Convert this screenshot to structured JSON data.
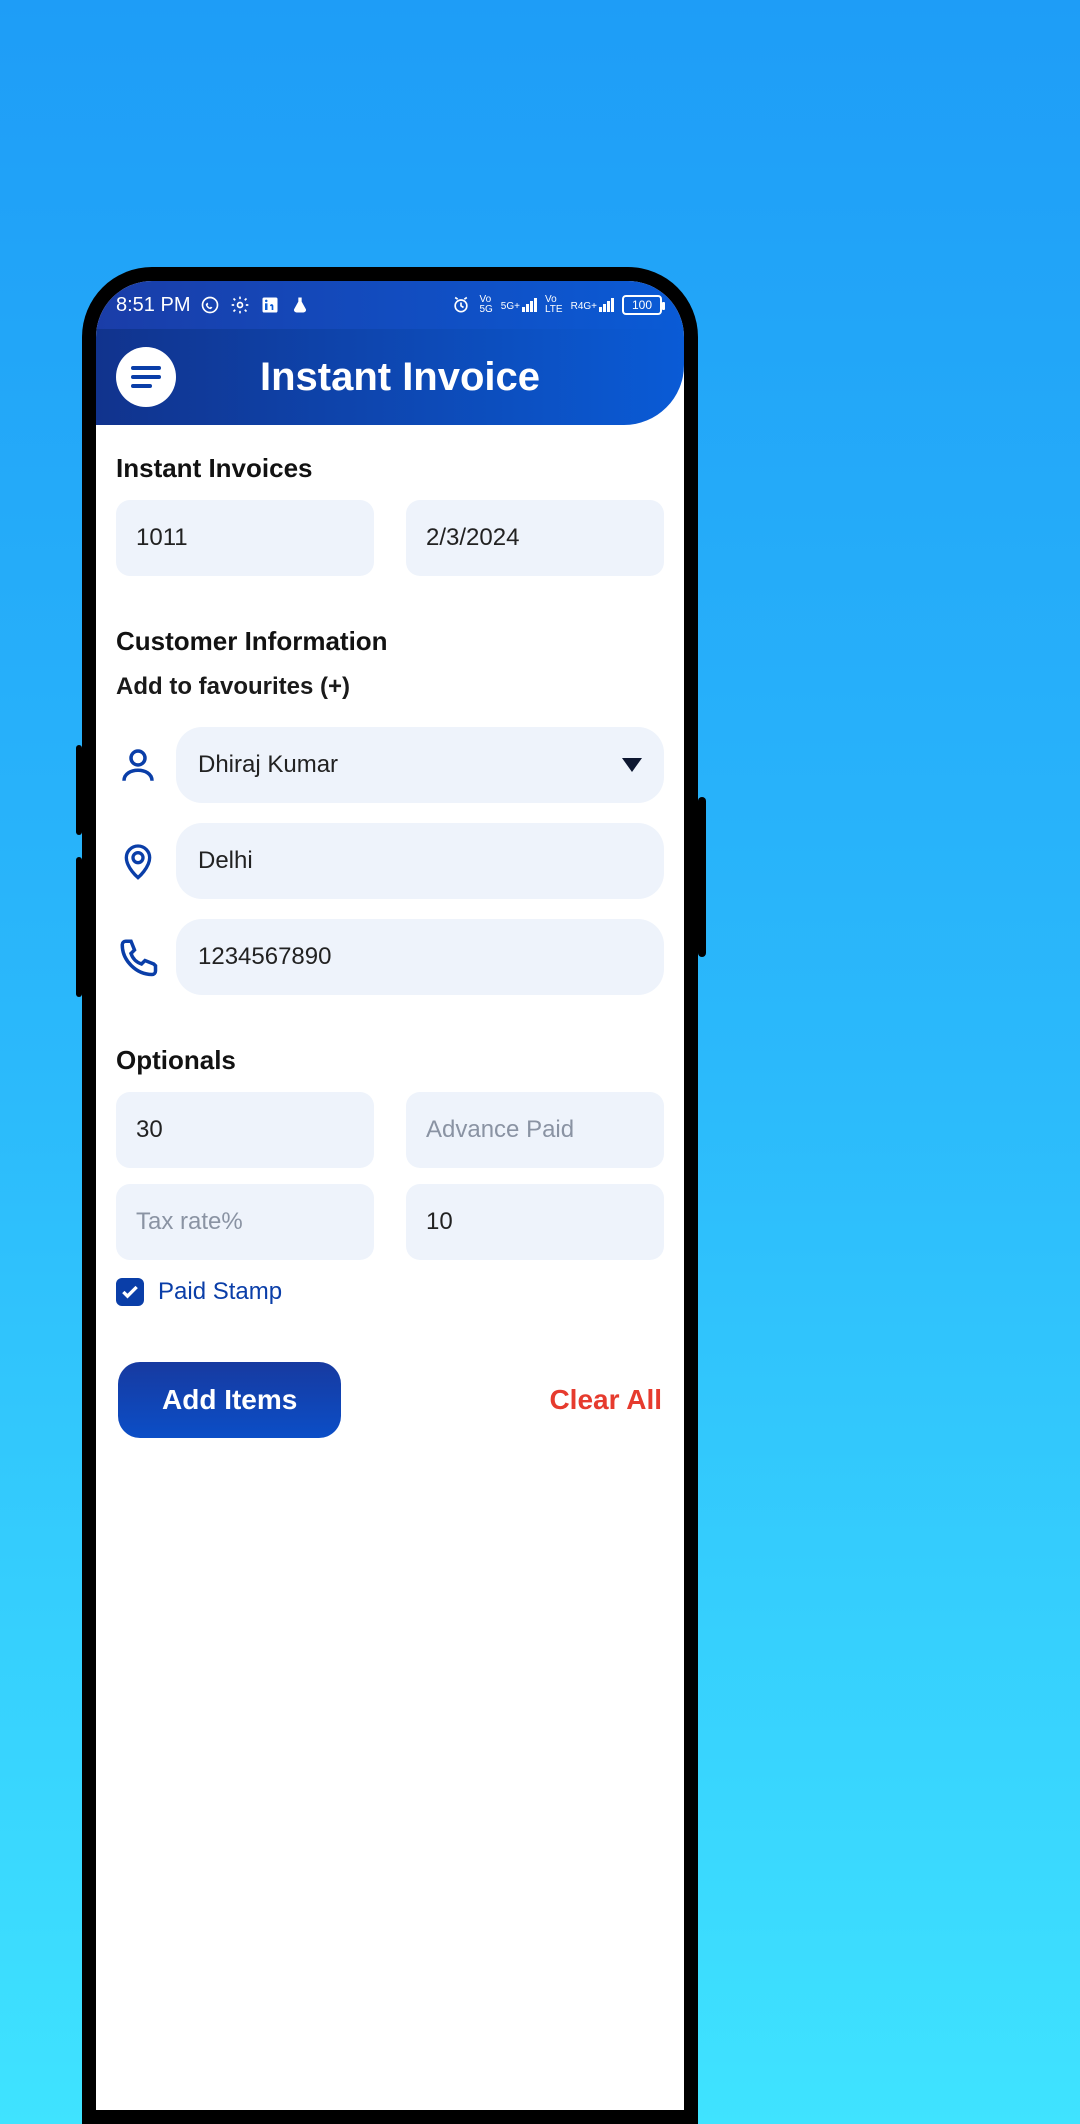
{
  "statusbar": {
    "time": "8:51 PM",
    "net1": "Vo 5G",
    "net2": "5G+",
    "net3": "Vo LTE",
    "net4": "R4G+",
    "battery": "100"
  },
  "appbar": {
    "title": "Instant Invoice"
  },
  "sections": {
    "invoices_heading": "Instant Invoices",
    "customer_heading": "Customer Information",
    "favourites_sub": "Add to favourites (+)",
    "optionals_heading": "Optionals"
  },
  "fields": {
    "invoice_no": "1011",
    "invoice_date": "2/3/2024",
    "customer_name": "Dhiraj Kumar",
    "customer_city": "Delhi",
    "customer_phone": "1234567890",
    "opt_quantity": "30",
    "opt_advance_placeholder": "Advance Paid",
    "opt_taxrate_placeholder": "Tax rate%",
    "opt_other": "10",
    "paid_stamp_label": "Paid Stamp",
    "paid_stamp_checked": true
  },
  "actions": {
    "add_items": "Add Items",
    "clear_all": "Clear All"
  }
}
